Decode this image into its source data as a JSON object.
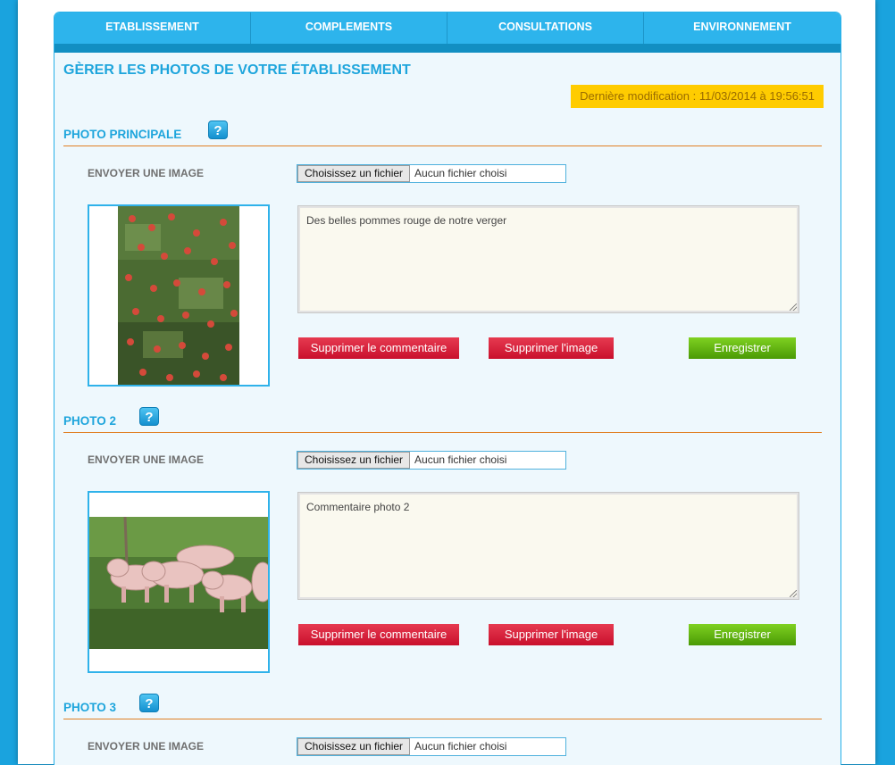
{
  "tabs": [
    {
      "label": "ETABLISSEMENT"
    },
    {
      "label": "COMPLEMENTS"
    },
    {
      "label": "CONSULTATIONS"
    },
    {
      "label": "ENVIRONNEMENT"
    }
  ],
  "page_title": "GÈRER LES PHOTOS DE VOTRE ÉTABLISSEMENT",
  "last_modified": "Dernière modification : 11/03/2014 à 19:56:51",
  "help_symbol": "?",
  "labels": {
    "send_image": "ENVOYER UNE IMAGE",
    "file_button": "Choisissez un fichier",
    "file_none": "Aucun fichier choisi",
    "delete_comment": "Supprimer le commentaire",
    "delete_image": "Supprimer l'image",
    "save": "Enregistrer"
  },
  "photos": [
    {
      "title": "PHOTO PRINCIPALE",
      "comment": "Des belles pommes rouge de notre verger",
      "image": "apple-tree-photo"
    },
    {
      "title": "PHOTO 2",
      "comment": "Commentaire photo 2",
      "image": "pigs-in-field-photo"
    },
    {
      "title": "PHOTO 3"
    }
  ],
  "colors": {
    "accent": "#1ea5dc",
    "tab_bg": "#2db4ec",
    "rule": "#e07f24",
    "badge_bg": "#ffcc00",
    "danger": "#d51a36",
    "success": "#5cb010"
  }
}
